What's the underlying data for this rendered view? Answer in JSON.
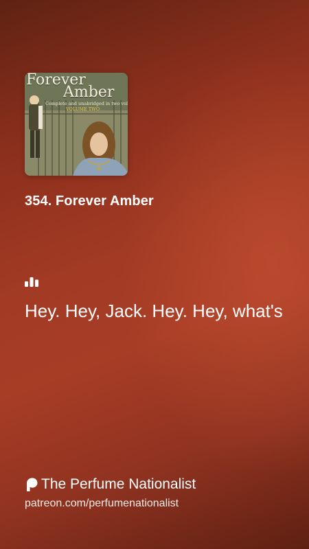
{
  "cover": {
    "title_line1": "Forever",
    "title_line2": "Amber",
    "subtitle": "Complete and unabridged in two volumes",
    "volume": "VOLUME TWO",
    "icon": "book-cover-image"
  },
  "episode": {
    "title": "354. Forever Amber"
  },
  "waveform": {
    "icon": "audio-waveform-icon"
  },
  "transcript": {
    "text": "Hey. Hey, Jack. Hey. Hey, what's"
  },
  "podcast": {
    "icon": "patreon-icon",
    "name": "The Perfume Nationalist",
    "url": "patreon.com/perfumenationalist"
  },
  "colors": {
    "background_light": "#a83d26",
    "background_dark": "#5f2213",
    "text": "#ffffff"
  }
}
